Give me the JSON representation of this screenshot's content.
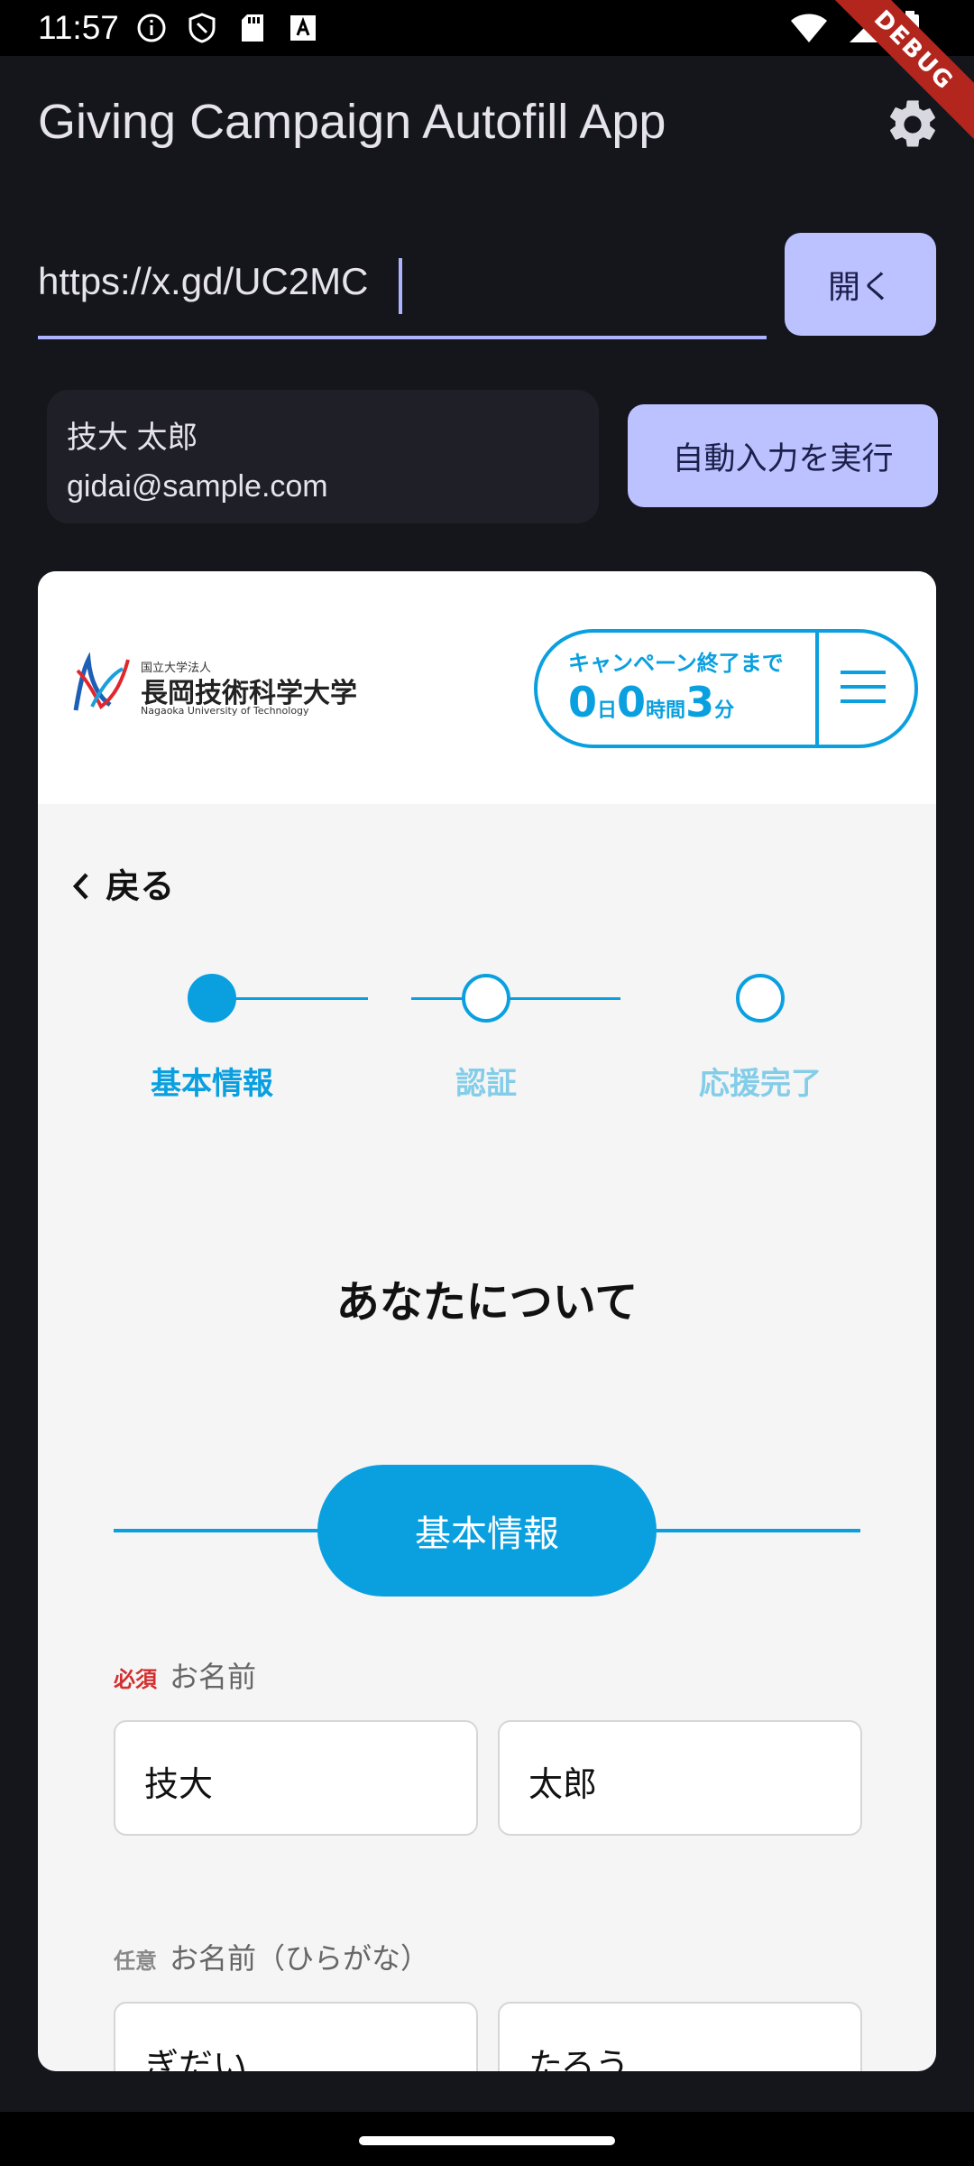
{
  "status_bar": {
    "time": "11:57",
    "icons_left": [
      "info-icon",
      "shield-icon",
      "sd-card-icon",
      "font-icon"
    ],
    "icons_right": [
      "wifi-icon",
      "signal-icon",
      "battery-icon"
    ],
    "debug_label": "DEBUG"
  },
  "app_bar": {
    "title": "Giving Campaign Autofill App",
    "settings_icon": "gear-icon"
  },
  "url_bar": {
    "value": "https://x.gd/UC2MC",
    "open_label": "開く"
  },
  "profile": {
    "name": "技大 太郎",
    "email": "gidai@sample.com",
    "autofill_label": "自動入力を実行"
  },
  "web": {
    "logo": {
      "small": "国立大学法人",
      "name": "長岡技術科学大学",
      "english": "Nagaoka University of Technology"
    },
    "countdown": {
      "label": "キャンペーン終了まで",
      "days": "0",
      "days_unit": "日",
      "hours": "0",
      "hours_unit": "時間",
      "minutes": "3",
      "minutes_unit": "分"
    },
    "back_label": "戻る",
    "steps": [
      {
        "label": "基本情報",
        "active": true
      },
      {
        "label": "認証",
        "active": false
      },
      {
        "label": "応援完了",
        "active": false
      }
    ],
    "section_title": "あなたについて",
    "pill_label": "基本情報",
    "name_field": {
      "required_tag": "必須",
      "label": "お名前",
      "last_name": "技大",
      "first_name": "太郎"
    },
    "kana_field": {
      "optional_tag": "任意",
      "label": "お名前（ひらがな）",
      "last_name": "ぎだい",
      "first_name": "たろう"
    }
  },
  "colors": {
    "background": "#15161c",
    "accent": "#bcc2ff",
    "web_accent": "#0aa0e0",
    "required": "#d32f2f"
  }
}
